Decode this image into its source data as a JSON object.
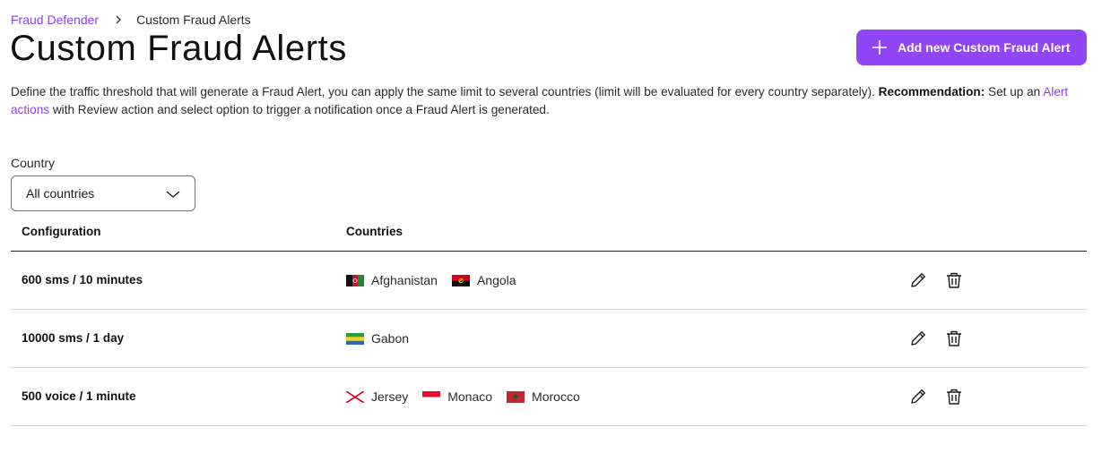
{
  "breadcrumb": {
    "parent": "Fraud Defender",
    "current": "Custom Fraud Alerts"
  },
  "page": {
    "title": "Custom Fraud Alerts",
    "add_button": "Add new Custom Fraud Alert",
    "description_part1": "Define the traffic threshold that will generate a Fraud Alert, you can apply the same limit to several countries (limit will be evaluated for every country separately). ",
    "description_bold": "Recommendation:",
    "description_part2": " Set up an ",
    "description_link": "Alert actions",
    "description_part3": " with Review action and select option to trigger a notification once a Fraud Alert is generated."
  },
  "filter": {
    "label": "Country",
    "selected": "All countries"
  },
  "table": {
    "headers": {
      "configuration": "Configuration",
      "countries": "Countries"
    },
    "rows": [
      {
        "configuration": "600 sms / 10 minutes",
        "countries": [
          "Afghanistan",
          "Angola"
        ]
      },
      {
        "configuration": "10000 sms / 1 day",
        "countries": [
          "Gabon"
        ]
      },
      {
        "configuration": "500 voice / 1 minute",
        "countries": [
          "Jersey",
          "Monaco",
          "Morocco"
        ]
      }
    ]
  },
  "colors": {
    "accent": "#9146f5",
    "link": "#8a3ffc"
  },
  "icons": {
    "add": "plus-icon",
    "select": "chevron-down-icon",
    "edit": "pencil-icon",
    "delete": "trash-icon"
  }
}
